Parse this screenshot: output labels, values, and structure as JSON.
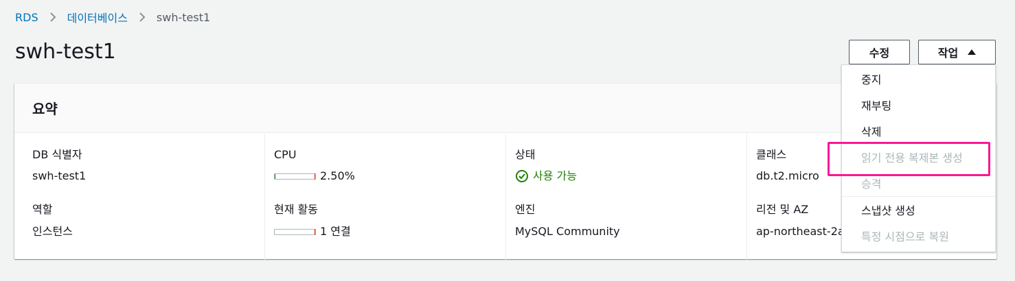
{
  "breadcrumb": {
    "items": [
      {
        "label": "RDS"
      },
      {
        "label": "데이터베이스"
      },
      {
        "label": "swh-test1"
      }
    ]
  },
  "page": {
    "title": "swh-test1"
  },
  "header_actions": {
    "modify_label": "수정",
    "actions_label": "작업"
  },
  "summary": {
    "title": "요약",
    "db_identifier_label": "DB 식별자",
    "db_identifier_value": "swh-test1",
    "role_label": "역할",
    "role_value": "인스턴스",
    "cpu_label": "CPU",
    "cpu_value": "2.50%",
    "cpu_fraction": 0.025,
    "activity_label": "현재 활동",
    "activity_value": "1 연결",
    "activity_fraction": 0.0,
    "status_label": "상태",
    "status_value": "사용 가능",
    "status_color": "#1d8102",
    "engine_label": "엔진",
    "engine_value": "MySQL Community",
    "class_label": "클래스",
    "class_value": "db.t2.micro",
    "region_label": "리전 및 AZ",
    "region_value": "ap-northeast-2a"
  },
  "actions_menu": {
    "items": [
      {
        "label": "중지",
        "disabled": false
      },
      {
        "label": "재부팅",
        "disabled": false
      },
      {
        "label": "삭제",
        "disabled": false
      },
      {
        "label": "읽기 전용 복제본 생성",
        "disabled": true
      },
      {
        "label": "승격",
        "disabled": true
      },
      {
        "label": "스냅샷 생성",
        "disabled": false
      },
      {
        "label": "특정 시점으로 복원",
        "disabled": true
      }
    ]
  },
  "colors": {
    "link": "#0073bb",
    "highlight": "#ff1493",
    "disabled_text": "#aab7b8"
  },
  "icons": {
    "breadcrumb_separator": "chevron-right-icon",
    "actions_caret": "caret-up-icon",
    "status": "check-circle-icon"
  }
}
